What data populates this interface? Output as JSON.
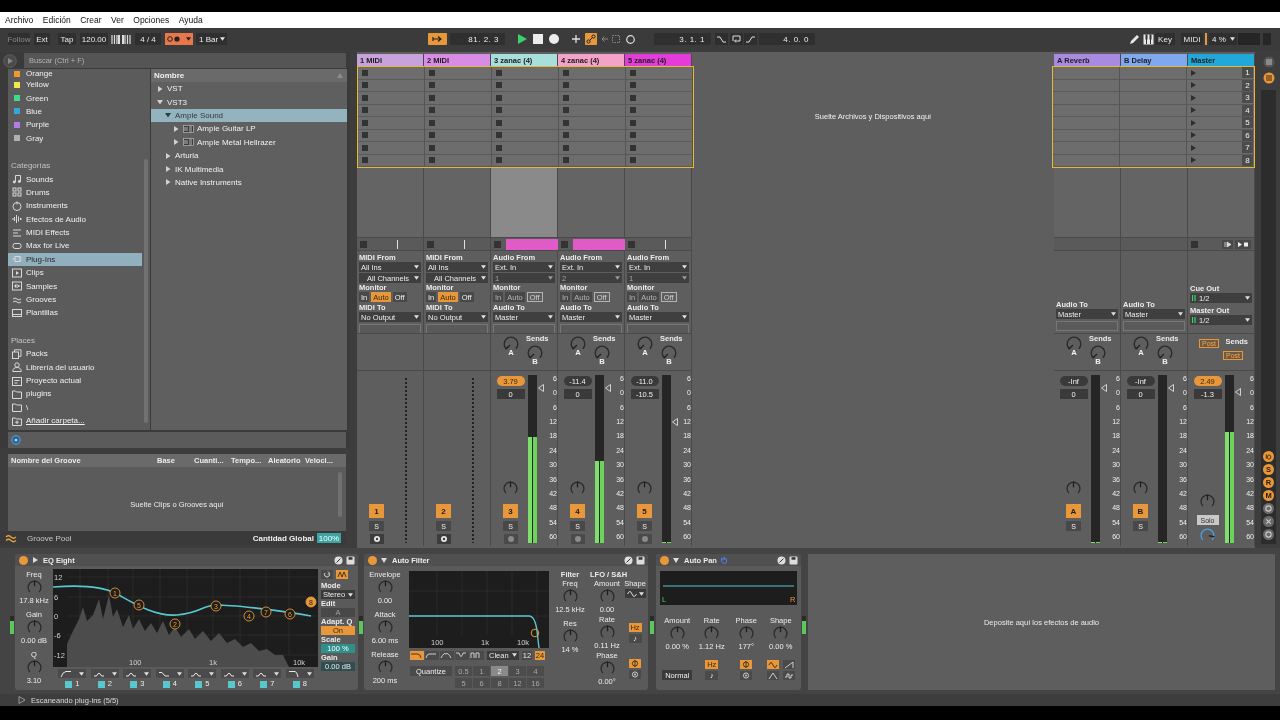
{
  "menu": [
    "Archivo",
    "Edición",
    "Crear",
    "Ver",
    "Opciones",
    "Ayuda"
  ],
  "control_bar": {
    "follow": {
      "label": "Follow",
      "on": false
    },
    "ext": "Ext",
    "tap": "Tap",
    "tempo": "120.00",
    "signature": "4 / 4",
    "metronome": {
      "on": true
    },
    "quantization": "1 Bar",
    "arrangement_follow": {
      "on": true
    },
    "position": "81. 2. 3",
    "playing": true,
    "recording": false,
    "automation_arm": {
      "on": true
    },
    "loop_start": "3. 1. 1",
    "loop_length": "4. 0. 0",
    "key": "Key",
    "midi": "MIDI",
    "cpu": "4 %"
  },
  "browser": {
    "search": {
      "placeholder": "Buscar (Ctrl + F)"
    },
    "collections": [
      {
        "label": "Orange",
        "color": "#f2992e",
        "selected": false
      },
      {
        "label": "Yellow",
        "color": "#f0e84c",
        "selected": false
      },
      {
        "label": "Green",
        "color": "#3ddc8c",
        "selected": false
      },
      {
        "label": "Blue",
        "color": "#38a6dc",
        "selected": false
      },
      {
        "label": "Purple",
        "color": "#b07ee6",
        "selected": false
      },
      {
        "label": "Gray",
        "color": "#b0b0b0",
        "selected": false
      }
    ],
    "categories": {
      "heading": "Categorías",
      "items": [
        {
          "label": "Sounds",
          "kind": "sounds",
          "selected": false
        },
        {
          "label": "Drums",
          "kind": "drums",
          "selected": false
        },
        {
          "label": "Instruments",
          "kind": "instruments",
          "selected": false
        },
        {
          "label": "Efectos de Audio",
          "kind": "audio_effects",
          "selected": false
        },
        {
          "label": "MIDI Effects",
          "kind": "midi_effects",
          "selected": false
        },
        {
          "label": "Max for Live",
          "kind": "max",
          "selected": false
        },
        {
          "label": "Plug-Ins",
          "kind": "plugins",
          "selected": true
        },
        {
          "label": "Clips",
          "kind": "clips",
          "selected": false
        },
        {
          "label": "Samples",
          "kind": "samples",
          "selected": false
        },
        {
          "label": "Grooves",
          "kind": "grooves",
          "selected": false
        },
        {
          "label": "Plantillas",
          "kind": "templates",
          "selected": false
        }
      ]
    },
    "places": {
      "heading": "Places",
      "items": [
        {
          "label": "Packs",
          "kind": "packs",
          "selected": false
        },
        {
          "label": "Librería del usuario",
          "kind": "user",
          "selected": false
        },
        {
          "label": "Proyecto actual",
          "kind": "project",
          "selected": false
        },
        {
          "label": "plugins",
          "kind": "folder",
          "selected": false
        },
        {
          "label": "\\",
          "kind": "folder",
          "selected": false
        },
        {
          "label": "Añadir carpeta...",
          "kind": "add",
          "selected": false
        }
      ]
    },
    "column": "Nombre",
    "tree": [
      {
        "label": "VST",
        "expanded": false,
        "selected": false
      },
      {
        "label": "VST3",
        "expanded": true,
        "selected": false,
        "children": [
          {
            "label": "Ample Sound",
            "expanded": true,
            "selected": true,
            "children": [
              {
                "label": "Ample Guitar LP",
                "kind": "plugin",
                "expanded": false,
                "selected": false
              },
              {
                "label": "Ample Metal Hellrazer",
                "kind": "plugin",
                "expanded": false,
                "selected": false
              }
            ]
          },
          {
            "label": "Arturia",
            "expanded": false,
            "selected": false
          },
          {
            "label": "IK Multimedia",
            "expanded": false,
            "selected": false
          },
          {
            "label": "Native Instruments",
            "expanded": false,
            "selected": false
          }
        ]
      }
    ]
  },
  "groove_pool": {
    "columns": [
      "Nombre del Groove",
      "Base",
      "Cuanti...",
      "Tempo...",
      "Aleatorio",
      "Veloci..."
    ],
    "empty_message": "Suelte Clips o Grooves aquí",
    "title": "Groove Pool",
    "amount_label": "Cantidad Global",
    "amount": "100%"
  },
  "session": {
    "drop_message": "Suelte Archivos y Dispositivos aquí",
    "scenes": [
      {
        "number": "1"
      },
      {
        "number": "2"
      },
      {
        "number": "3"
      },
      {
        "number": "4"
      },
      {
        "number": "5"
      },
      {
        "number": "6"
      },
      {
        "number": "7"
      },
      {
        "number": "8"
      }
    ],
    "tracks": [
      {
        "name": "1 MIDI",
        "color": "#c8a2dc",
        "kind": "midi",
        "selected": false,
        "playing": false,
        "input": {
          "label": "MIDI From",
          "source": "All Ins",
          "channel": {
            "value": "All Channels",
            "disabled": false
          }
        },
        "monitor": {
          "label": "Monitor",
          "disabled": false,
          "options": [
            {
              "label": "In",
              "selected": false
            },
            {
              "label": "Auto",
              "selected": true
            },
            {
              "label": "Off",
              "selected": false
            }
          ]
        },
        "output": {
          "label": "MIDI To",
          "target": "No Output"
        },
        "number": {
          "label": "1",
          "on": true
        },
        "solo": "S",
        "arm": false
      },
      {
        "name": "2 MIDI",
        "color": "#d98ce6",
        "kind": "midi",
        "selected": false,
        "playing": false,
        "input": {
          "label": "MIDI From",
          "source": "All Ins",
          "channel": {
            "value": "All Channels",
            "disabled": false
          }
        },
        "monitor": {
          "label": "Monitor",
          "disabled": false,
          "options": [
            {
              "label": "In",
              "selected": false
            },
            {
              "label": "Auto",
              "selected": true
            },
            {
              "label": "Off",
              "selected": false
            }
          ]
        },
        "output": {
          "label": "MIDI To",
          "target": "No Output"
        },
        "number": {
          "label": "2",
          "on": true
        },
        "solo": "S",
        "arm": false
      },
      {
        "name": "3 zanac (4)",
        "color": "#a8dedc",
        "kind": "audio",
        "selected": true,
        "playing": true,
        "input": {
          "label": "Audio From",
          "source": "Ext. In",
          "channel": {
            "value": "1",
            "disabled": true
          }
        },
        "monitor": {
          "label": "Monitor",
          "disabled": true,
          "options": [
            {
              "label": "In",
              "selected": false
            },
            {
              "label": "Auto",
              "selected": false
            },
            {
              "label": "Off",
              "selected": true
            }
          ]
        },
        "output": {
          "label": "Audio To",
          "target": "Master"
        },
        "sends": {
          "label": "Sends",
          "knobs": [
            {
              "label": "A"
            },
            {
              "label": "B"
            }
          ]
        },
        "peak": {
          "value": "3.79",
          "over": true
        },
        "volume": {
          "value": "0",
          "level": 0.92
        },
        "meter": {
          "level": 0.63
        },
        "scale": [
          "6",
          "0",
          "6",
          "12",
          "18",
          "24",
          "30",
          "36",
          "42",
          "48",
          "54",
          "60"
        ],
        "number": {
          "label": "3",
          "on": true
        },
        "solo": "S",
        "arm": false
      },
      {
        "name": "4 zanac (4)",
        "color": "#f4a2c8",
        "kind": "audio",
        "selected": false,
        "playing": true,
        "input": {
          "label": "Audio From",
          "source": "Ext. In",
          "channel": {
            "value": "2",
            "disabled": true
          }
        },
        "monitor": {
          "label": "Monitor",
          "disabled": true,
          "options": [
            {
              "label": "In",
              "selected": false
            },
            {
              "label": "Auto",
              "selected": false
            },
            {
              "label": "Off",
              "selected": true
            }
          ]
        },
        "output": {
          "label": "Audio To",
          "target": "Master"
        },
        "sends": {
          "label": "Sends",
          "knobs": [
            {
              "label": "A"
            },
            {
              "label": "B"
            }
          ]
        },
        "peak": {
          "value": "-11.4",
          "over": false
        },
        "volume": {
          "value": "0",
          "level": 0.92
        },
        "meter": {
          "level": 0.49
        },
        "scale": [
          "6",
          "0",
          "6",
          "12",
          "18",
          "24",
          "30",
          "36",
          "42",
          "48",
          "54",
          "60"
        ],
        "number": {
          "label": "4",
          "on": true
        },
        "solo": "S",
        "arm": false
      },
      {
        "name": "5 zanac (4)",
        "color": "#e43cd8",
        "kind": "audio",
        "selected": false,
        "playing": false,
        "input": {
          "label": "Audio From",
          "source": "Ext. In",
          "channel": {
            "value": "1",
            "disabled": true
          }
        },
        "monitor": {
          "label": "Monitor",
          "disabled": true,
          "options": [
            {
              "label": "In",
              "selected": false
            },
            {
              "label": "Auto",
              "selected": false
            },
            {
              "label": "Off",
              "selected": true
            }
          ]
        },
        "output": {
          "label": "Audio To",
          "target": "Master"
        },
        "sends": {
          "label": "Sends",
          "knobs": [
            {
              "label": "A"
            },
            {
              "label": "B"
            }
          ]
        },
        "peak": {
          "value": "-11.0",
          "over": false
        },
        "volume": {
          "value": "-10.5",
          "level": 0.72
        },
        "meter": {
          "level": 0
        },
        "scale": [
          "6",
          "0",
          "6",
          "12",
          "18",
          "24",
          "30",
          "36",
          "42",
          "48",
          "54",
          "60"
        ],
        "number": {
          "label": "5",
          "on": true
        },
        "solo": "S",
        "arm": false
      }
    ],
    "returns": [
      {
        "name": "A Reverb",
        "color": "#a88be0",
        "output": {
          "label": "Audio To",
          "target": "Master"
        },
        "sends": {
          "label": "Sends",
          "knobs": [
            {
              "label": "A"
            },
            {
              "label": "B"
            }
          ]
        },
        "peak": {
          "value": "-Inf",
          "over": false
        },
        "volume": {
          "value": "0",
          "level": 0.92
        },
        "meter": {
          "level": 0
        },
        "scale": [
          "6",
          "0",
          "6",
          "12",
          "18",
          "24",
          "30",
          "36",
          "42",
          "48",
          "54",
          "60"
        ],
        "letter": {
          "label": "A",
          "on": true
        },
        "solo": "S"
      },
      {
        "name": "B Delay",
        "color": "#80a8ee",
        "output": {
          "label": "Audio To",
          "target": "Master"
        },
        "sends": {
          "label": "Sends",
          "knobs": [
            {
              "label": "A"
            },
            {
              "label": "B"
            }
          ]
        },
        "peak": {
          "value": "-Inf",
          "over": false
        },
        "volume": {
          "value": "0",
          "level": 0.92
        },
        "meter": {
          "level": 0
        },
        "scale": [
          "6",
          "0",
          "6",
          "12",
          "18",
          "24",
          "30",
          "36",
          "42",
          "48",
          "54",
          "60"
        ],
        "letter": {
          "label": "B",
          "on": true
        },
        "solo": "S"
      }
    ],
    "master": {
      "name": "Master",
      "color": "#22a8d8",
      "cue_out": {
        "label": "Cue Out",
        "value": "1/2"
      },
      "master_out": {
        "label": "Master Out",
        "value": "1/2"
      },
      "sends": {
        "label": "Sends",
        "buttons": [
          "Post",
          "Post"
        ]
      },
      "peak": {
        "value": "2.49",
        "over": true
      },
      "volume": {
        "value": "-1.3",
        "level": 0.9
      },
      "meter": {
        "level": 0.66
      },
      "scale": [
        "6",
        "0",
        "6",
        "12",
        "18",
        "24",
        "30",
        "36",
        "42",
        "48",
        "54",
        "60"
      ],
      "solo": "Solo"
    }
  },
  "mixer_toggles": [
    {
      "label": "S",
      "on": true
    },
    {
      "label": "R",
      "on": true
    },
    {
      "label": "M",
      "on": true
    }
  ],
  "devices": [
    {
      "kind": "eq_eight",
      "title": "EQ Eight",
      "on": true,
      "params": [
        {
          "label": "Freq",
          "value": "17.8 kHz"
        },
        {
          "label": "Gain",
          "value": "0.00 dB"
        },
        {
          "label": "Q",
          "value": "3.10"
        }
      ],
      "y_labels": [
        "12",
        "6",
        "0",
        "-6",
        "-12"
      ],
      "x_labels": [
        "100",
        "1k",
        "10k"
      ],
      "bands": [
        {
          "marker": "1",
          "label": "1",
          "kind": "low_cut",
          "on": true,
          "selected": false
        },
        {
          "marker": "2",
          "label": "2",
          "kind": "bell",
          "on": true,
          "selected": false
        },
        {
          "marker": "3",
          "label": "3",
          "kind": "bell",
          "on": true,
          "selected": false
        },
        {
          "marker": "4",
          "label": "4",
          "kind": "low_shelf",
          "on": true,
          "selected": false
        },
        {
          "marker": "5",
          "label": "5",
          "kind": "bell",
          "on": true,
          "selected": false
        },
        {
          "marker": "6",
          "label": "6",
          "kind": "bell",
          "on": true,
          "selected": false
        },
        {
          "marker": "7",
          "label": "7",
          "kind": "bell",
          "on": true,
          "selected": false
        },
        {
          "marker": "8",
          "label": "8",
          "kind": "high_cut",
          "on": true,
          "selected": true
        }
      ],
      "audition": {
        "on": true
      },
      "side": [
        {
          "kind": "dropdown",
          "label": "Mode",
          "value": "Stereo"
        },
        {
          "kind": "disabled",
          "label": "Edit",
          "value": "A"
        },
        {
          "kind": "toggle",
          "label": "Adapt. Q",
          "value": "On"
        },
        {
          "kind": "field",
          "label": "Scale",
          "value": "100 %"
        },
        {
          "kind": "field_dark",
          "label": "Gain",
          "value": "0.00 dB"
        }
      ]
    },
    {
      "kind": "auto_filter",
      "title": "Auto Filter",
      "on": true,
      "envelope": [
        {
          "label": "Envelope",
          "value": "0.00"
        },
        {
          "label": "Attack",
          "value": "6.00 ms"
        },
        {
          "label": "Release",
          "value": "200 ms"
        }
      ],
      "x_labels": [
        "100",
        "1k",
        "10k"
      ],
      "filter_types": [
        {
          "kind": "lowpass",
          "selected": true
        },
        {
          "kind": "highpass",
          "selected": false
        },
        {
          "kind": "bandpass",
          "selected": false
        },
        {
          "kind": "notch",
          "selected": false
        },
        {
          "kind": "morph",
          "selected": false
        }
      ],
      "circuit": "Clean",
      "slopes": [
        {
          "label": "12",
          "selected": false
        },
        {
          "label": "24",
          "selected": true
        }
      ],
      "quantize": {
        "label": "Quantize",
        "on": false,
        "options": [
          {
            "label": "0.5",
            "selected": false
          },
          {
            "label": "1",
            "selected": false
          },
          {
            "label": "2",
            "selected": true
          },
          {
            "label": "3",
            "selected": false
          },
          {
            "label": "4",
            "selected": false
          },
          {
            "label": "5",
            "selected": false
          },
          {
            "label": "6",
            "selected": false
          },
          {
            "label": "8",
            "selected": false
          },
          {
            "label": "12",
            "selected": false
          },
          {
            "label": "16",
            "selected": false
          }
        ]
      },
      "filter": {
        "heading": "Filter",
        "params": [
          {
            "label": "Freq",
            "value": "12.5 kHz"
          },
          {
            "label": "Res",
            "value": "14 %"
          }
        ]
      },
      "lfo": {
        "heading": "LFO / S&H",
        "amount": {
          "label": "Amount",
          "value": "0.00"
        },
        "shape": {
          "label": "Shape"
        },
        "rate": {
          "label": "Rate",
          "value": "0.11 Hz"
        },
        "phase": {
          "label": "Phase",
          "value": "0.00°"
        },
        "units": [
          {
            "label": "Hz",
            "selected": true
          },
          {
            "label": "♪",
            "selected": false
          }
        ],
        "phase_modes": [
          {
            "kind": "phase",
            "selected": true
          },
          {
            "kind": "spin",
            "selected": false
          }
        ]
      }
    },
    {
      "kind": "auto_pan",
      "title": "Auto Pan",
      "on": true,
      "display": {
        "left": "L",
        "right": "R"
      },
      "params": [
        {
          "label": "Amount",
          "value": "0.00 %"
        },
        {
          "label": "Rate",
          "value": "1.12 Hz"
        },
        {
          "label": "Phase",
          "value": "177°"
        },
        {
          "label": "Shape",
          "value": "0.00 %"
        }
      ],
      "units": [
        {
          "label": "Hz",
          "selected": true
        },
        {
          "label": "♪",
          "selected": false
        }
      ],
      "phase_modes": [
        {
          "kind": "phase",
          "selected": true
        },
        {
          "kind": "spin",
          "selected": false
        }
      ],
      "shapes": [
        {
          "kind": "sine",
          "selected": true
        },
        {
          "kind": "saw",
          "selected": false
        },
        {
          "kind": "triangle",
          "selected": false
        },
        {
          "kind": "random",
          "selected": false
        }
      ],
      "mode": "Normal"
    }
  ],
  "device_drop_message": "Deposite aquí los efectos de audio",
  "status_bar": {
    "message": "Escaneando plug-ins (5/5)"
  }
}
